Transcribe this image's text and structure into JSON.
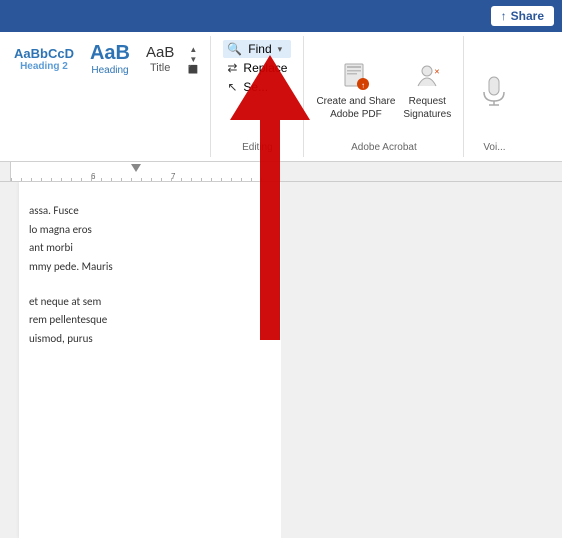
{
  "topbar": {
    "share_label": "Share",
    "share_icon": "↑"
  },
  "ribbon": {
    "styles": {
      "sample_text": "AaBbCcD",
      "heading_display": "AaB",
      "heading2_label": "Heading 2",
      "title_label": "Title"
    },
    "editing": {
      "find_label": "Find",
      "replace_label": "Replace",
      "select_label": "Se...",
      "section_label": "Editing",
      "find_dropdown": "▾",
      "find_icon": "🔍",
      "replace_icon": "⇄",
      "select_icon": "↖"
    },
    "adobe": {
      "create_label": "Create and Share\nAdobe PDF",
      "request_label": "Request\nSignatures",
      "section_label": "Adobe Acrobat"
    },
    "voice": {
      "section_label": "Voi..."
    }
  },
  "ruler": {
    "ticks": [
      "6",
      "7"
    ]
  },
  "document": {
    "paragraphs": [
      "assa. Fusce",
      "lo magna eros",
      "ant morbi",
      "mmy pede. Mauris",
      "",
      "et neque at sem",
      "rem pellentesque",
      "uismod, purus"
    ]
  }
}
